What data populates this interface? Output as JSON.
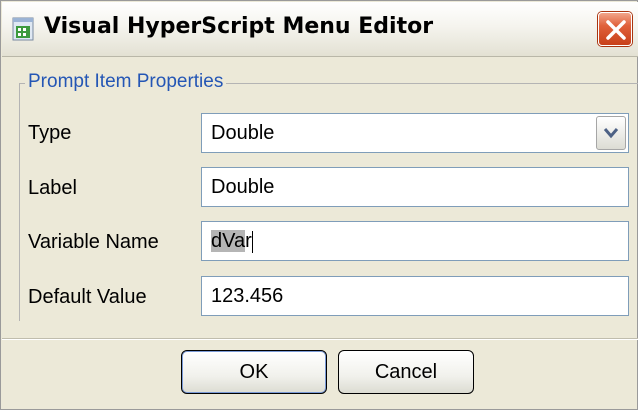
{
  "window": {
    "title": "Visual HyperScript Menu Editor",
    "app_icon": "hyperscript-app-icon",
    "close_icon": "close-icon"
  },
  "group": {
    "legend": "Prompt Item Properties"
  },
  "fields": {
    "type": {
      "label": "Type",
      "value": "Double",
      "control": "dropdown",
      "options_visible": [
        "Double"
      ]
    },
    "label": {
      "label": "Label",
      "value": "Double"
    },
    "variable_name": {
      "label": "Variable Name",
      "value_selected": "dVa",
      "value_rest": "r"
    },
    "default_value": {
      "label": "Default Value",
      "value": "123.456"
    }
  },
  "buttons": {
    "ok": "OK",
    "cancel": "Cancel"
  },
  "colors": {
    "legend_text": "#2456b5",
    "dialog_background": "#ece9d8",
    "field_border": "#7f9db9",
    "close_button": "#e0613b"
  }
}
